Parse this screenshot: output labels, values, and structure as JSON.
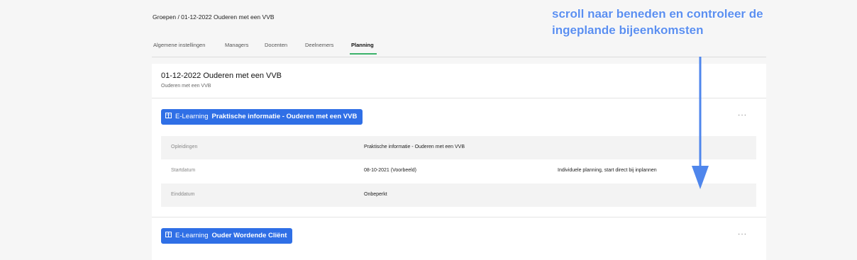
{
  "breadcrumb": "Groepen / 01-12-2022 Ouderen met een VVB",
  "tabs": [
    {
      "label": "Algemene instellingen",
      "active": false
    },
    {
      "label": "Managers",
      "active": false
    },
    {
      "label": "Docenten",
      "active": false
    },
    {
      "label": "Deelnemers",
      "active": false
    },
    {
      "label": "Planning",
      "active": true
    }
  ],
  "group": {
    "title": "01-12-2022 Ouderen met een VVB",
    "subtitle": "Ouderen met een VVB"
  },
  "sections": [
    {
      "type": "E-Learning",
      "name": "Praktische informatie - Ouderen met een VVB",
      "menu": "···",
      "rows": [
        {
          "label": "Opleidingen",
          "value": "Praktische informatie - Ouderen met een VVB",
          "extra": ""
        },
        {
          "label": "Startdatum",
          "value": "08-10-2021 (Voorbeeld)",
          "extra": "Individuele planning, start direct bij inplannen"
        },
        {
          "label": "Einddatum",
          "value": "Onbeperkt",
          "extra": ""
        }
      ]
    },
    {
      "type": "E-Learning",
      "name": "Ouder Wordende Cliënt",
      "menu": "···"
    }
  ],
  "annotation": {
    "line1": "scroll naar beneden en controleer de",
    "line2": "ingeplande bijeenkomsten"
  },
  "colors": {
    "accent_blue": "#2f6fe6",
    "tab_active_underline": "#3bb26a",
    "annotation_blue": "#5b8ff0"
  },
  "icons": {
    "course_type": "book-icon",
    "menu": "more-dots-icon",
    "annotation_arrow": "down-arrow-icon"
  }
}
